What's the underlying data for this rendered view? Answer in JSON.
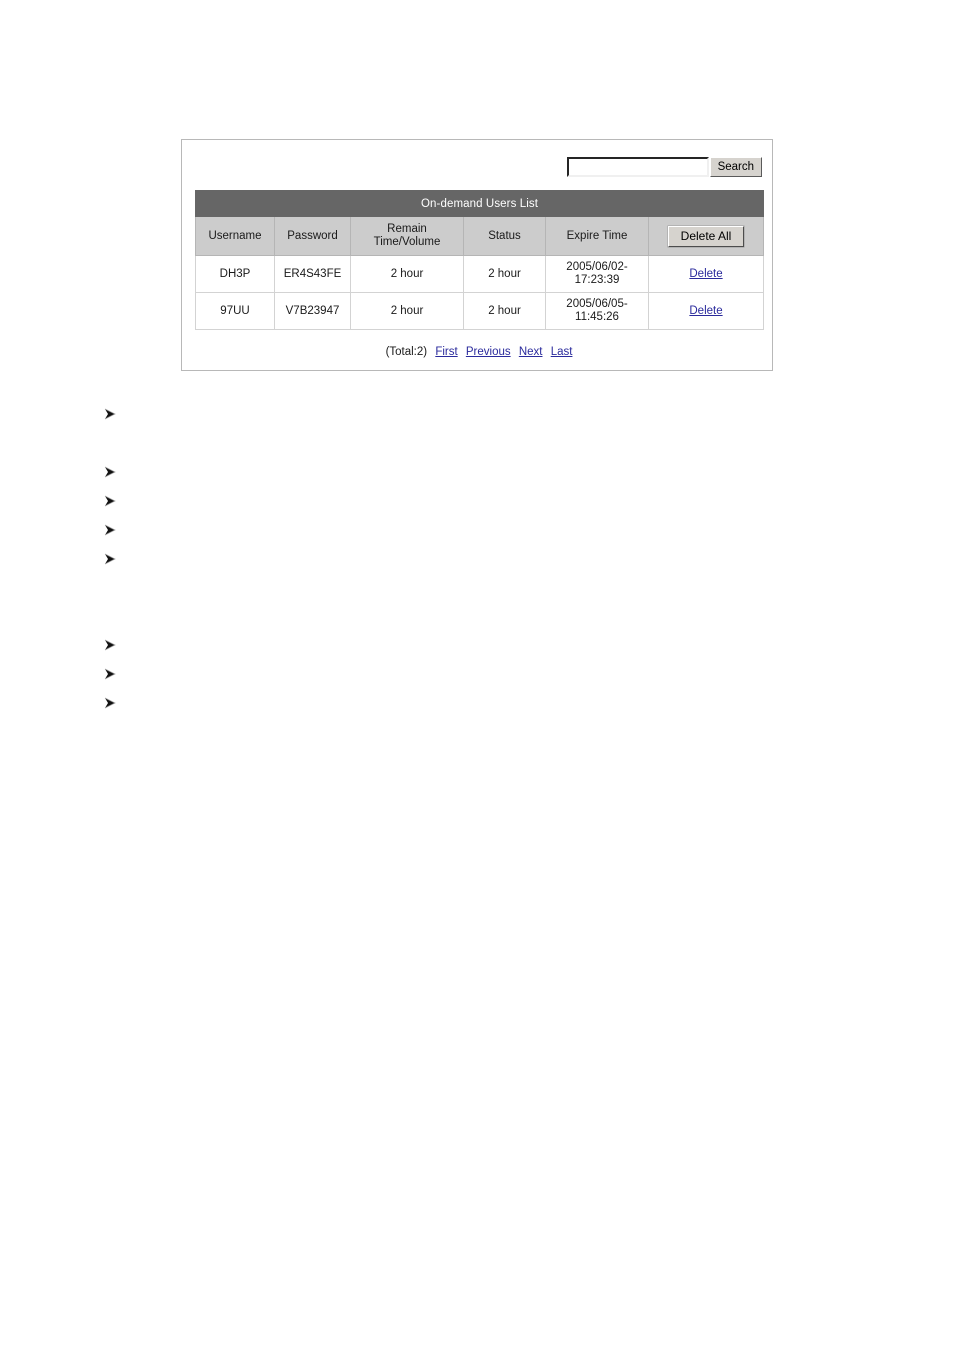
{
  "screenshot": {
    "search": {
      "input_value": "",
      "input_placeholder": "",
      "button_label": "Search"
    },
    "table": {
      "title": "On-demand Users List",
      "columns": [
        "Username",
        "Password",
        "Remain Time/Volume",
        "Status",
        "Expire Time"
      ],
      "column_remain_line1": "Remain",
      "column_remain_line2": "Time/Volume",
      "delete_all_label": "Delete All",
      "rows": [
        {
          "username": "DH3P",
          "password": "ER4S43FE",
          "remain": "2 hour",
          "status": "2 hour",
          "expire_line1": "2005/06/02-",
          "expire_line2": "17:23:39",
          "action_label": "Delete"
        },
        {
          "username": "97UU",
          "password": "V7B23947",
          "remain": "2 hour",
          "status": "2 hour",
          "expire_line1": "2005/06/05-",
          "expire_line2": "11:45:26",
          "action_label": "Delete"
        }
      ]
    },
    "pagination": {
      "total": "(Total:2)",
      "first": "First",
      "previous": "Previous",
      "next": "Next",
      "last": "Last"
    },
    "colors": {
      "title_bar": "#666666",
      "column_header": "#cccccc",
      "link": "#2a2a9c",
      "button_face": "#d6d3ce"
    }
  },
  "document": {
    "bullet_glyph": "arrow-bullet",
    "bullets_group_one": [
      "",
      "",
      "",
      "",
      ""
    ],
    "bullets_group_two": [
      "",
      "",
      ""
    ]
  }
}
